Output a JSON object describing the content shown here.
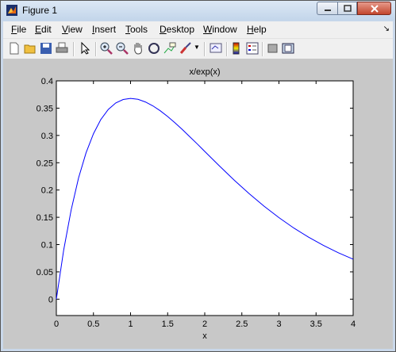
{
  "window": {
    "title": "Figure 1",
    "app_icon": "matlab-icon",
    "buttons": [
      "minimize-icon",
      "maximize-icon",
      "close-icon"
    ]
  },
  "menu": [
    {
      "label": "File",
      "u": "F",
      "rest": "ile"
    },
    {
      "label": "Edit",
      "u": "E",
      "rest": "dit"
    },
    {
      "label": "View",
      "u": "V",
      "rest": "iew"
    },
    {
      "label": "Insert",
      "u": "I",
      "rest": "nsert"
    },
    {
      "label": "Tools",
      "u": "T",
      "rest": "ools"
    },
    {
      "label": "Desktop",
      "u": "D",
      "rest": "esktop"
    },
    {
      "label": "Window",
      "u": "W",
      "rest": "indow"
    },
    {
      "label": "Help",
      "u": "H",
      "rest": "elp"
    }
  ],
  "toolbar": [
    "new-figure-icon",
    "open-file-icon",
    "save-icon",
    "print-icon",
    "edit-plot-arrow-icon",
    "zoom-in-icon",
    "zoom-out-icon",
    "pan-hand-icon",
    "rotate-3d-icon",
    "data-cursor-icon",
    "brush-icon",
    "link-plot-icon",
    "colorbar-icon",
    "legend-icon",
    "hide-plot-tools-icon",
    "show-plot-tools-icon"
  ],
  "chart_data": {
    "type": "line",
    "title": "x/exp(x)",
    "xlabel": "x",
    "ylabel": "",
    "xlim": [
      0,
      4
    ],
    "ylim": [
      -0.03,
      0.4
    ],
    "xticks": [
      "0",
      "0.5",
      "1",
      "1.5",
      "2",
      "2.5",
      "3",
      "3.5",
      "4"
    ],
    "yticks": [
      "0",
      "0.05",
      "0.1",
      "0.15",
      "0.2",
      "0.25",
      "0.3",
      "0.35",
      "0.4"
    ],
    "grid": false,
    "series": [
      {
        "color": "#0000ff",
        "x": [
          0,
          0.1,
          0.2,
          0.3,
          0.4,
          0.5,
          0.6,
          0.7,
          0.8,
          0.9,
          1.0,
          1.1,
          1.2,
          1.3,
          1.4,
          1.5,
          1.6,
          1.7,
          1.8,
          1.9,
          2.0,
          2.2,
          2.4,
          2.6,
          2.8,
          3.0,
          3.2,
          3.4,
          3.6,
          3.8,
          4.0
        ],
        "values": [
          0,
          0.0905,
          0.1637,
          0.2222,
          0.2681,
          0.3033,
          0.3293,
          0.3476,
          0.3595,
          0.3659,
          0.3679,
          0.3662,
          0.3614,
          0.3543,
          0.3452,
          0.3347,
          0.323,
          0.3106,
          0.2975,
          0.2842,
          0.2707,
          0.2438,
          0.2177,
          0.1931,
          0.1703,
          0.1494,
          0.1304,
          0.1135,
          0.0984,
          0.0851,
          0.0733
        ]
      }
    ]
  }
}
